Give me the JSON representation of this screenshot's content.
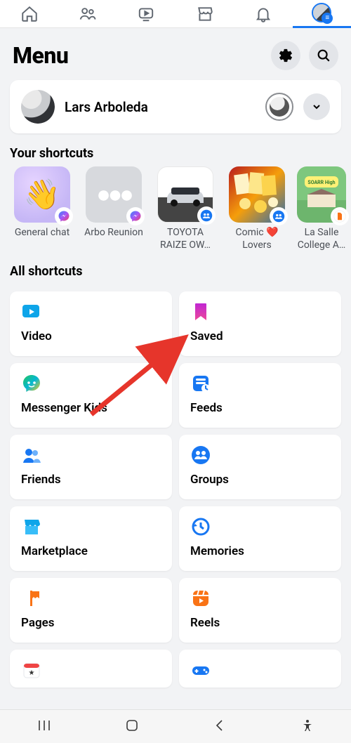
{
  "header": {
    "title": "Menu"
  },
  "profile": {
    "name": "Lars Arboleda"
  },
  "shortcuts_section_title": "Your shortcuts",
  "shortcuts": [
    {
      "label": "General chat",
      "badge": "messenger",
      "thumb": "wave"
    },
    {
      "label": "Arbo Reunion",
      "badge": "messenger",
      "thumb": "dots"
    },
    {
      "label": "TOYOTA RAIZE OW…",
      "badge": "group",
      "thumb": "car"
    },
    {
      "label": "Comic ❤️ Lovers",
      "badge": "group",
      "thumb": "comics"
    },
    {
      "label": "La Salle College A…",
      "badge": "page",
      "thumb": "campus"
    }
  ],
  "all_section_title": "All shortcuts",
  "tiles": [
    {
      "label": "Video",
      "icon": "video"
    },
    {
      "label": "Saved",
      "icon": "saved"
    },
    {
      "label": "Messenger Kids",
      "icon": "mkids"
    },
    {
      "label": "Feeds",
      "icon": "feeds"
    },
    {
      "label": "Friends",
      "icon": "friends"
    },
    {
      "label": "Groups",
      "icon": "groups"
    },
    {
      "label": "Marketplace",
      "icon": "marketplace"
    },
    {
      "label": "Memories",
      "icon": "memories"
    },
    {
      "label": "Pages",
      "icon": "pages"
    },
    {
      "label": "Reels",
      "icon": "reels"
    },
    {
      "label": "",
      "icon": "events"
    },
    {
      "label": "",
      "icon": "gaming"
    }
  ]
}
